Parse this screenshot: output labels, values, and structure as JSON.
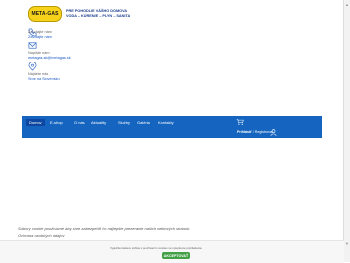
{
  "header": {
    "logo_text": "META-GAS",
    "slogan_line1": "PRE POHODLIE VÁŠHO DOMOVA",
    "slogan_line2": "VODA – KÚRENIE – PLYN – SANITA"
  },
  "contacts": {
    "phone": {
      "label": "Zavolajte nám",
      "value": "Zavolajte nám"
    },
    "email": {
      "label": "Napíšte nám",
      "value": "metagas.sk@metagas.sk"
    },
    "location": {
      "label": "Nájdete nás",
      "value": "Sme na Slovensku"
    }
  },
  "nav": {
    "items": [
      "Domov",
      "E-shop",
      "O nás",
      "Aktuality",
      "Služby",
      "Galéria",
      "Kontakty"
    ],
    "login_label": "Prihlásiť",
    "register_label": "Registrovať"
  },
  "cookie": {
    "text": "Súbory cookie používame aby sme zabezpečili čo najlepšie prezeranie našich webových stránok.",
    "link_text": "Ochrana osobných údajov",
    "notice_text": "Vyjadrite láskavo súhlas s používaním cookies na vylepšenie prehliadania.",
    "accept_label": "AKCEPTOVAŤ"
  },
  "colors": {
    "nav_background": "#1565c0",
    "accept_button": "#43a047",
    "brand_yellow": "#f6d21a"
  }
}
